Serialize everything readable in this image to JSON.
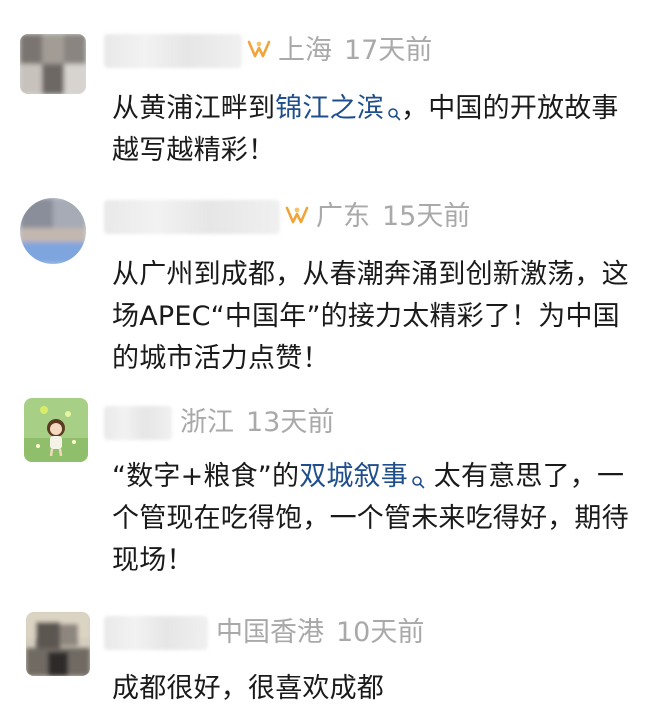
{
  "comments": [
    {
      "location": "上海",
      "time": "17天前",
      "has_badge": true,
      "text_before": "从黄浦江畔到",
      "link": "锦江之滨",
      "text_after": "，中国的开放故事越写越精彩！"
    },
    {
      "location": "广东",
      "time": "15天前",
      "has_badge": true,
      "text": "从广州到成都，从春潮奔涌到创新激荡，这场APEC“中国年”的接力太精彩了！为中国的城市活力点赞！"
    },
    {
      "location": "浙江",
      "time": "13天前",
      "has_badge": false,
      "text_before": "“数字+粮食”的",
      "link": "双城叙事",
      "text_after": " 太有意思了，一个管现在吃得饱，一个管未来吃得好，期待现场！"
    },
    {
      "location": "中国香港",
      "time": "10天前",
      "has_badge": false,
      "text": "成都很好，很喜欢成都"
    }
  ],
  "colors": {
    "meta": "#a9a9a9",
    "link": "#1f4e8c",
    "badge": "#f0a53a"
  },
  "icons": {
    "badge": "fan-badge-icon",
    "link": "search-icon"
  }
}
